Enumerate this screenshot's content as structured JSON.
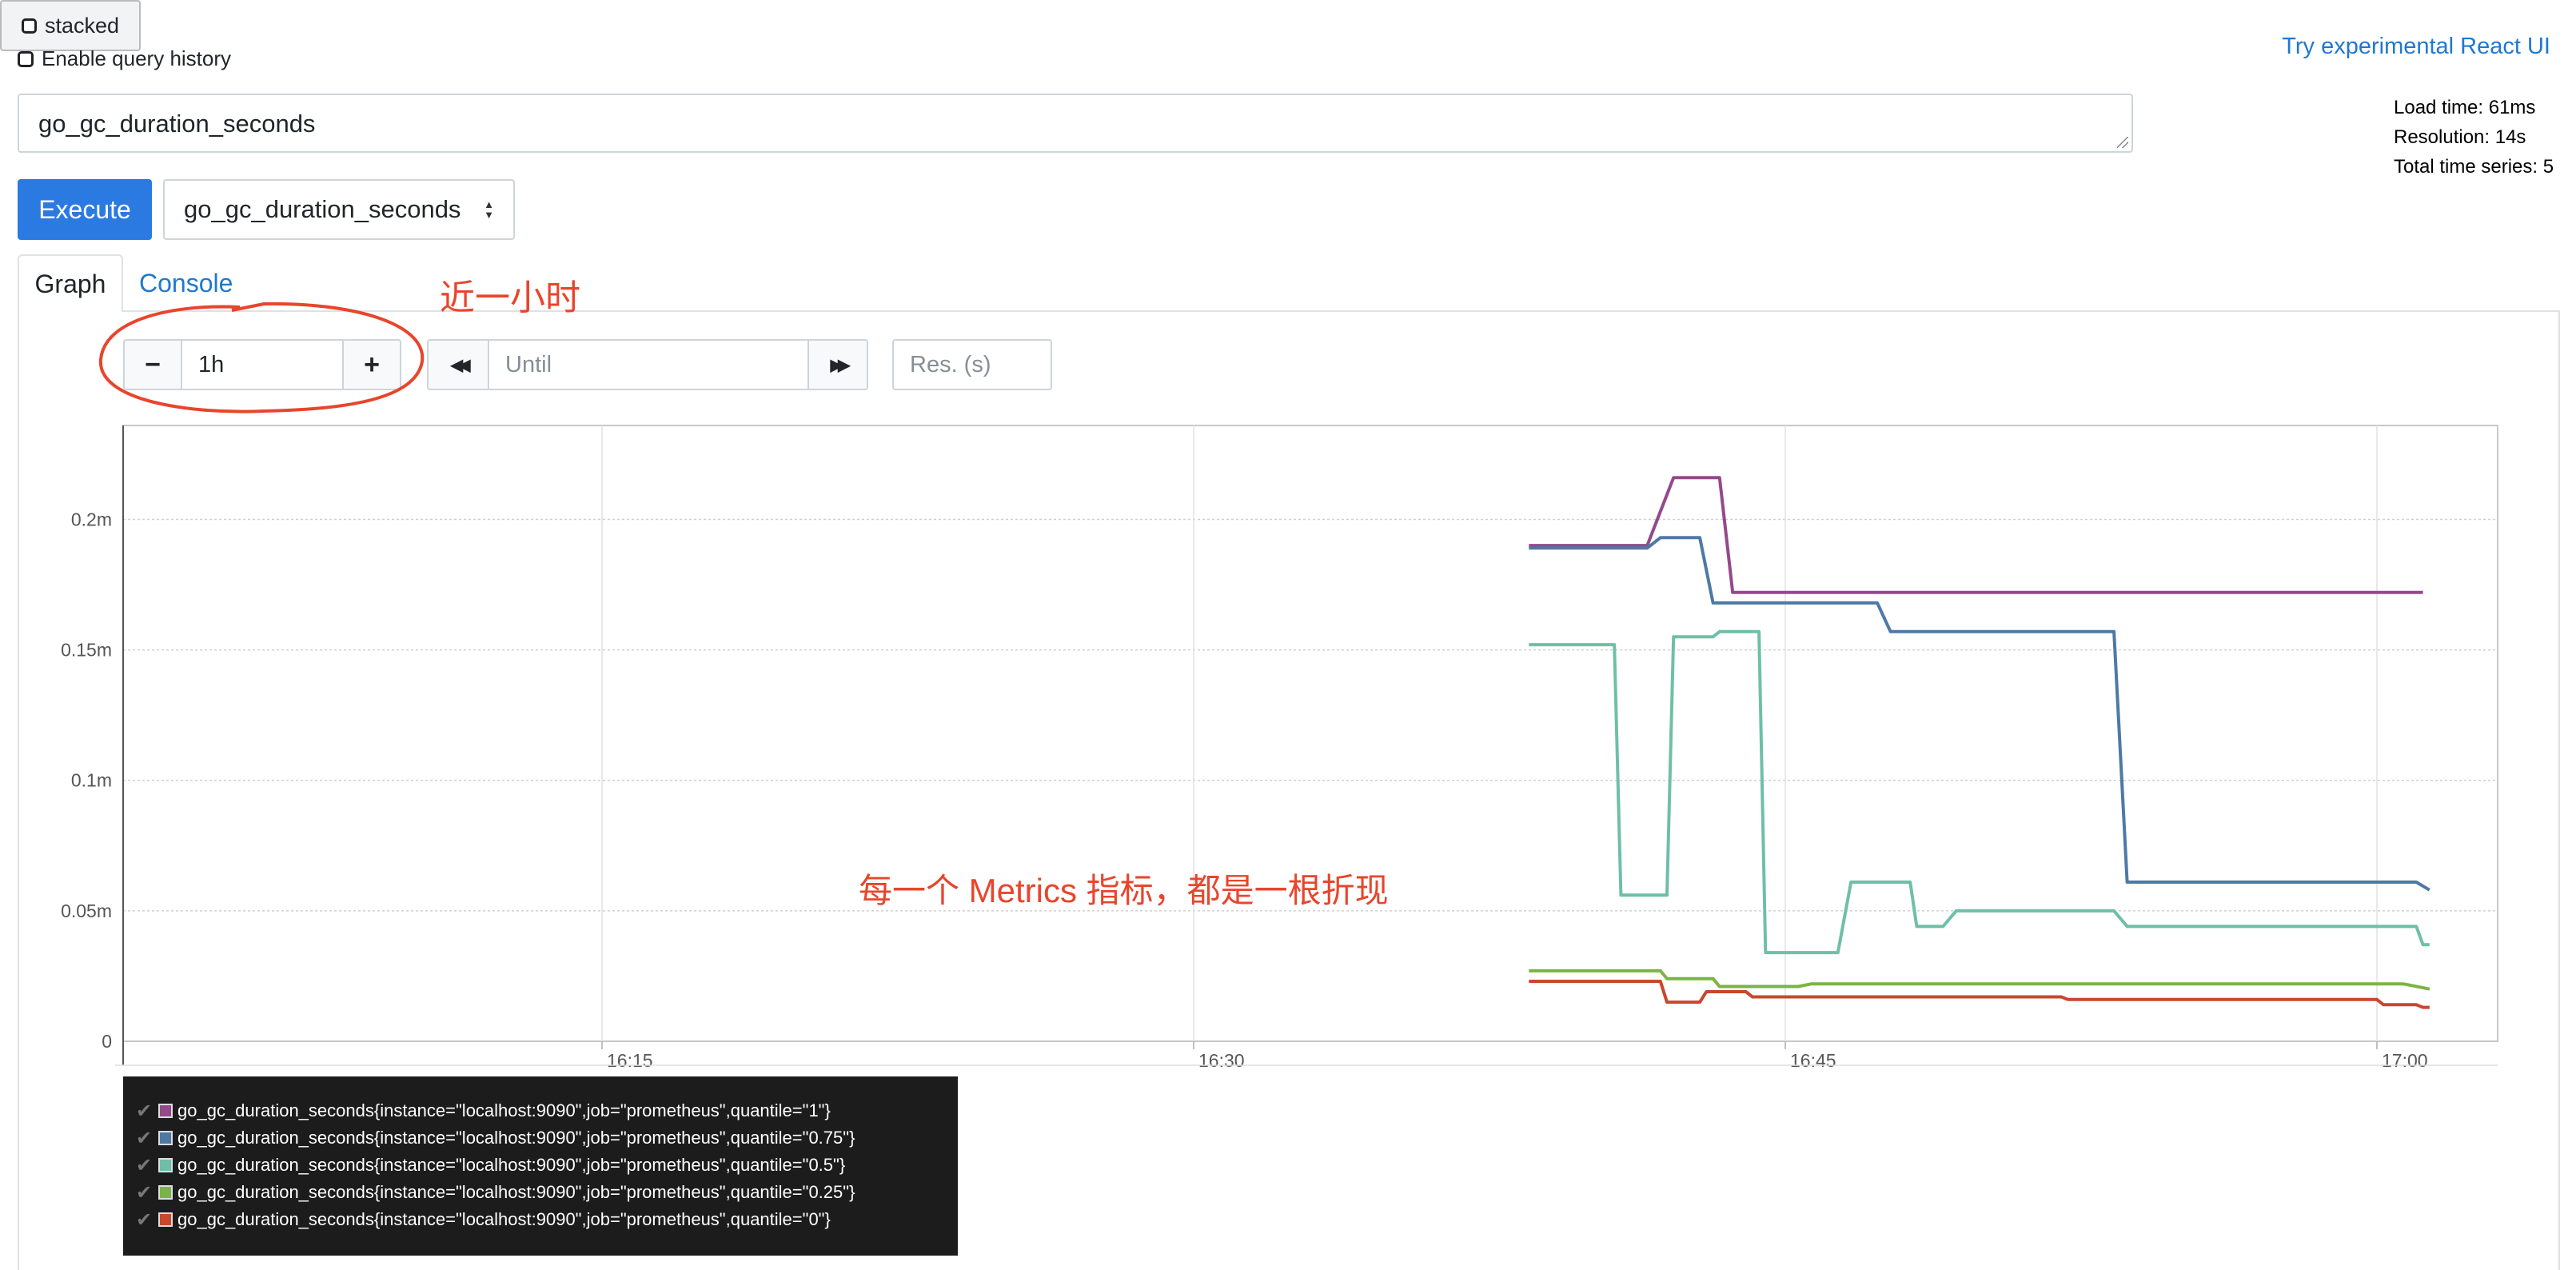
{
  "top": {
    "enable_history_label": "Enable query history",
    "react_link": "Try experimental React UI"
  },
  "stats": {
    "load_time": "Load time: 61ms",
    "resolution": "Resolution: 14s",
    "total_series": "Total time series: 5"
  },
  "query": {
    "expression": "go_gc_duration_seconds",
    "execute_label": "Execute",
    "metric_select_value": "go_gc_duration_seconds"
  },
  "tabs": {
    "graph": "Graph",
    "console": "Console"
  },
  "controls": {
    "range_value": "1h",
    "until_placeholder": "Until",
    "res_placeholder": "Res. (s)",
    "stacked_label": "stacked",
    "minus": "−",
    "plus": "+",
    "back": "◀◀",
    "forward": "▶▶"
  },
  "annotations": {
    "range_note": "近一小时",
    "metrics_note": "每一个 Metrics 指标，都是一根折现"
  },
  "chart_data": {
    "type": "line",
    "x_ticks": [
      "16:15",
      "16:30",
      "16:45",
      "17:00"
    ],
    "y_ticks": [
      "0",
      "0.05m",
      "0.1m",
      "0.15m",
      "0.2m"
    ],
    "y_unit_note": "values in milliseconds ×1e-3 (m)",
    "ylim": [
      0,
      0.000236
    ],
    "grid": true,
    "legend_position": "bottom",
    "series": [
      {
        "name": "go_gc_duration_seconds{instance=\"localhost:9090\",job=\"prometheus\",quantile=\"1\"}",
        "color": "#94498b",
        "points": [
          [
            "16:38:30",
            0.00019
          ],
          [
            "16:41:30",
            0.00019
          ],
          [
            "16:42:10",
            0.000216
          ],
          [
            "16:43:20",
            0.000216
          ],
          [
            "16:43:40",
            0.000172
          ],
          [
            "17:01:10",
            0.000172
          ]
        ]
      },
      {
        "name": "go_gc_duration_seconds{instance=\"localhost:9090\",job=\"prometheus\",quantile=\"0.75\"}",
        "color": "#4e79a7",
        "points": [
          [
            "16:38:30",
            0.000189
          ],
          [
            "16:41:30",
            0.000189
          ],
          [
            "16:41:50",
            0.000193
          ],
          [
            "16:42:50",
            0.000193
          ],
          [
            "16:43:10",
            0.000168
          ],
          [
            "16:47:20",
            0.000168
          ],
          [
            "16:47:40",
            0.000157
          ],
          [
            "16:53:20",
            0.000157
          ],
          [
            "16:53:40",
            6.1e-05
          ],
          [
            "17:01:00",
            6.1e-05
          ],
          [
            "17:01:20",
            5.8e-05
          ]
        ]
      },
      {
        "name": "go_gc_duration_seconds{instance=\"localhost:9090\",job=\"prometheus\",quantile=\"0.5\"}",
        "color": "#6fbfa8",
        "points": [
          [
            "16:38:30",
            0.000152
          ],
          [
            "16:40:40",
            0.000152
          ],
          [
            "16:40:50",
            5.6e-05
          ],
          [
            "16:42:00",
            5.6e-05
          ],
          [
            "16:42:10",
            0.000155
          ],
          [
            "16:43:10",
            0.000155
          ],
          [
            "16:43:20",
            0.000157
          ],
          [
            "16:44:20",
            0.000157
          ],
          [
            "16:44:30",
            3.4e-05
          ],
          [
            "16:46:20",
            3.4e-05
          ],
          [
            "16:46:40",
            6.1e-05
          ],
          [
            "16:48:10",
            6.1e-05
          ],
          [
            "16:48:20",
            4.4e-05
          ],
          [
            "16:49:00",
            4.4e-05
          ],
          [
            "16:49:20",
            5e-05
          ],
          [
            "16:53:20",
            5e-05
          ],
          [
            "16:53:40",
            4.4e-05
          ],
          [
            "17:01:00",
            4.4e-05
          ],
          [
            "17:01:10",
            3.7e-05
          ],
          [
            "17:01:20",
            3.7e-05
          ]
        ]
      },
      {
        "name": "go_gc_duration_seconds{instance=\"localhost:9090\",job=\"prometheus\",quantile=\"0.25\"}",
        "color": "#7ab543",
        "points": [
          [
            "16:38:30",
            2.7e-05
          ],
          [
            "16:41:50",
            2.7e-05
          ],
          [
            "16:42:00",
            2.4e-05
          ],
          [
            "16:43:10",
            2.4e-05
          ],
          [
            "16:43:20",
            2.1e-05
          ],
          [
            "16:45:20",
            2.1e-05
          ],
          [
            "16:45:40",
            2.2e-05
          ],
          [
            "17:00:40",
            2.2e-05
          ],
          [
            "17:01:20",
            2e-05
          ]
        ]
      },
      {
        "name": "go_gc_duration_seconds{instance=\"localhost:9090\",job=\"prometheus\",quantile=\"0\"}",
        "color": "#c9472c",
        "points": [
          [
            "16:38:30",
            2.3e-05
          ],
          [
            "16:41:50",
            2.3e-05
          ],
          [
            "16:42:00",
            1.5e-05
          ],
          [
            "16:42:50",
            1.5e-05
          ],
          [
            "16:43:00",
            1.9e-05
          ],
          [
            "16:44:00",
            1.9e-05
          ],
          [
            "16:44:10",
            1.7e-05
          ],
          [
            "16:52:00",
            1.7e-05
          ],
          [
            "16:52:10",
            1.6e-05
          ],
          [
            "17:00:00",
            1.6e-05
          ],
          [
            "17:00:10",
            1.4e-05
          ],
          [
            "17:01:00",
            1.4e-05
          ],
          [
            "17:01:10",
            1.3e-05
          ],
          [
            "17:01:20",
            1.3e-05
          ]
        ]
      }
    ]
  }
}
